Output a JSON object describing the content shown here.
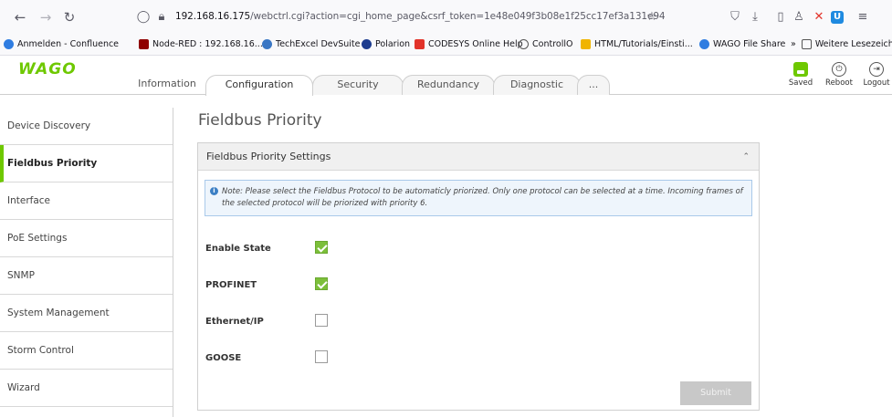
{
  "browser": {
    "url_host": "192.168.16.175",
    "url_path": "/webctrl.cgi?action=cgi_home_page&csrf_token=1e48e049f3b08e1f25cc17ef3a131e94",
    "bookmarks": [
      {
        "label": "Anmelden - Confluence",
        "color": "#2f7de1"
      },
      {
        "label": "Node-RED : 192.168.16...",
        "color": "#8f0000"
      },
      {
        "label": "TechExcel DevSuite",
        "color": "#3a76c4"
      },
      {
        "label": "Polarion",
        "color": "#1d3c8f"
      },
      {
        "label": "CODESYS Online Help",
        "color": "#e2332a"
      },
      {
        "label": "ControllO",
        "color": "#555555"
      },
      {
        "label": "HTML/Tutorials/Einsti...",
        "color": "#f0b400"
      },
      {
        "label": "WAGO File Share",
        "color": "#2f7de1"
      }
    ],
    "bookmarks_more": "Weitere Lesezeichen"
  },
  "header": {
    "logo": "WAGO",
    "tabs": [
      "Information",
      "Configuration",
      "Security",
      "Redundancy",
      "Diagnostic",
      "..."
    ],
    "active_tab": "Configuration",
    "tools": [
      {
        "label": "Saved",
        "icon": "save-icon"
      },
      {
        "label": "Reboot",
        "icon": "power-icon"
      },
      {
        "label": "Logout",
        "icon": "logout-icon"
      }
    ]
  },
  "sidebar": {
    "items": [
      {
        "label": "Device Discovery",
        "active": false
      },
      {
        "label": "Fieldbus Priority",
        "active": true
      },
      {
        "label": "Interface",
        "active": false
      },
      {
        "label": "PoE Settings",
        "active": false
      },
      {
        "label": "SNMP",
        "active": false
      },
      {
        "label": "System Management",
        "active": false
      },
      {
        "label": "Storm Control",
        "active": false
      },
      {
        "label": "Wizard",
        "active": false
      }
    ]
  },
  "main": {
    "title": "Fieldbus Priority",
    "panel_title": "Fieldbus Priority Settings",
    "note": "Note: Please select the Fieldbus Protocol to be automaticly priorized. Only one protocol can be selected at a time. Incoming frames of the selected protocol will be priorized with priority 6.",
    "settings": [
      {
        "label": "Enable State",
        "checked": true
      },
      {
        "label": "PROFINET",
        "checked": true
      },
      {
        "label": "Ethernet/IP",
        "checked": false
      },
      {
        "label": "GOOSE",
        "checked": false
      }
    ],
    "submit_label": "Submit"
  },
  "colors": {
    "brand_green": "#6ec800",
    "checkbox_green": "#7cbf3a",
    "note_bg": "#eef5fc",
    "note_border": "#a9c9ea"
  }
}
